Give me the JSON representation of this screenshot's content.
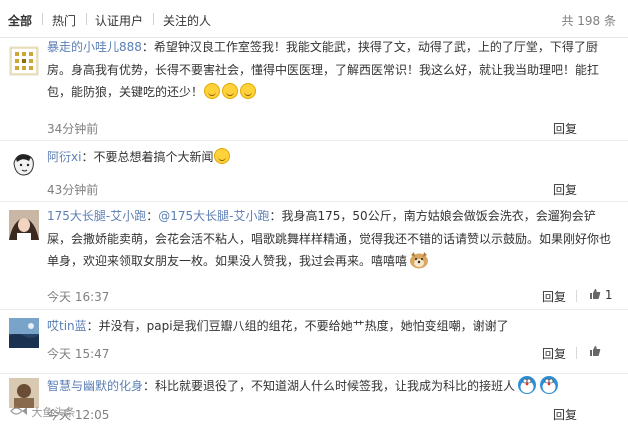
{
  "filter": {
    "tabs": [
      "全部",
      "热门",
      "认证用户",
      "关注的人"
    ],
    "active": "全部",
    "total": "共 198 条"
  },
  "comments": [
    {
      "user": "暴走的小哇儿888",
      "text_line1": "：希望钟汉良工作室签我！我能文能武，挟得了文，动得了武，上的了厅堂，下得了厨",
      "text_line2": "房。身高我有优势，长得不要害社会，懂得中医医理，了解西医常识！我这么好，就让我当助理吧！能扛",
      "text_line3": "包，能防狼，关键吃的还少！",
      "time": "34分钟前",
      "reply": "回复"
    },
    {
      "user": "阿衍xi",
      "text": "：不要总想着搞个大新闻",
      "time": "43分钟前",
      "reply": "回复"
    },
    {
      "user": "175大长腿-艾小跑",
      "mention": "@175大长腿-艾小跑",
      "text_line1": "：我身高175，50公斤，南方姑娘会做饭会洗衣，会遛狗会铲",
      "text_line2": "屎，会撒娇能卖萌，会花会活不粘人，唱歌跳舞样样精通，觉得我还不错的话请赞以示鼓励。如果刚好你也",
      "text_line3": "单身，欢迎来领取女朋友一枚。如果没人赞我，我过会再来。嘻嘻嘻",
      "time": "今天 16:37",
      "reply": "回复",
      "likes": "1"
    },
    {
      "user": "哎tin蓝",
      "text": "：并没有，papi是我们豆瓣八组的组花，不要给她艹热度，她怕变组嘲，谢谢了",
      "time": "今天 15:47",
      "reply": "回复"
    },
    {
      "user": "智慧与幽默的化身",
      "text": "：科比就要退役了，不知道湖人什么时候签我，让我成为科比的接班人",
      "time": "今天 12:05",
      "reply": "回复"
    }
  ],
  "watermark": "大鱼头条"
}
